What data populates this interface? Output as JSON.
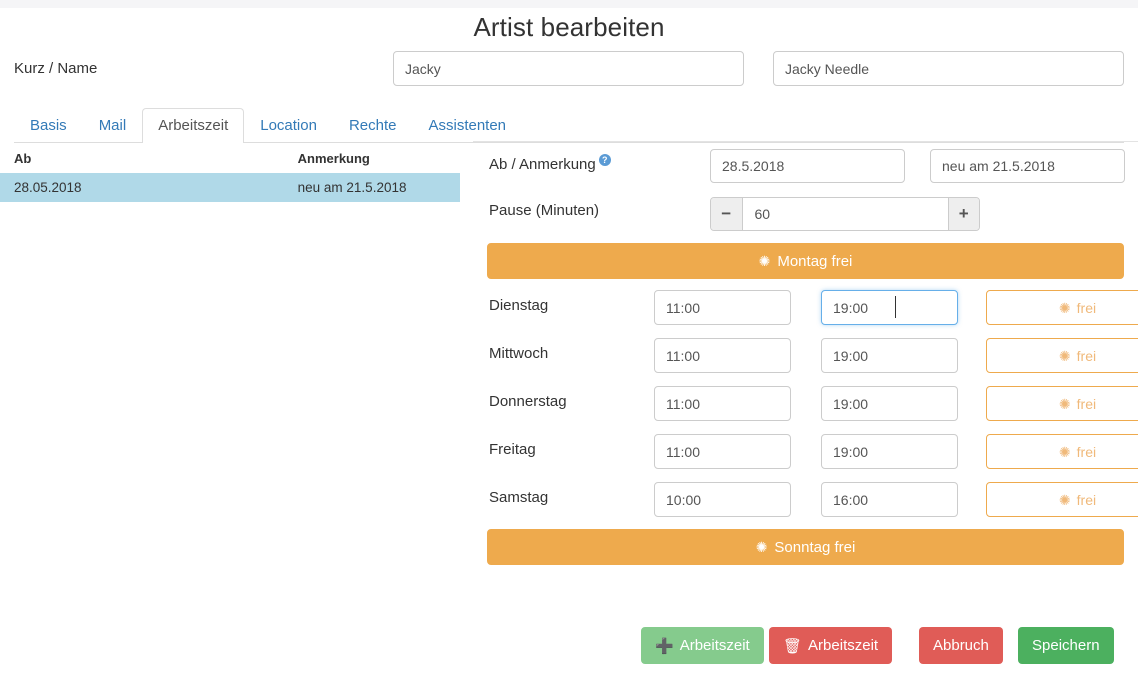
{
  "header": {
    "title": "Artist bearbeiten",
    "kurz_name_label": "Kurz / Name",
    "short_name_value": "Jacky",
    "full_name_value": "Jacky Needle"
  },
  "tabs": [
    {
      "label": "Basis",
      "active": false
    },
    {
      "label": "Mail",
      "active": false
    },
    {
      "label": "Arbeitszeit",
      "active": true
    },
    {
      "label": "Location",
      "active": false
    },
    {
      "label": "Rechte",
      "active": false
    },
    {
      "label": "Assistenten",
      "active": false
    }
  ],
  "table": {
    "headers": [
      "Ab",
      "Anmerkung"
    ],
    "rows": [
      {
        "ab": "28.05.2018",
        "anmerkung": "neu am 21.5.2018",
        "selected": true
      }
    ]
  },
  "form": {
    "ab_anmerkung_label": "Ab / Anmerkung",
    "help_icon": "question-mark-icon",
    "ab_date_value": "28.5.2018",
    "ab_note_value": "neu am 21.5.2018",
    "pause_label": "Pause (Minuten)",
    "pause_value": "60",
    "pause_minus_label": "−",
    "pause_plus_label": "+"
  },
  "schedule": {
    "monday_bar": {
      "label": "Montag frei",
      "icon": "sun-icon"
    },
    "sunday_bar": {
      "label": "Sonntag frei",
      "icon": "sun-icon"
    },
    "free_button_label": "frei",
    "free_button_icon": "sun-icon",
    "days": [
      {
        "name": "Dienstag",
        "from": "11:00",
        "to": "19:00",
        "focused": true
      },
      {
        "name": "Mittwoch",
        "from": "11:00",
        "to": "19:00",
        "focused": false
      },
      {
        "name": "Donnerstag",
        "from": "11:00",
        "to": "19:00",
        "focused": false
      },
      {
        "name": "Freitag",
        "from": "11:00",
        "to": "19:00",
        "focused": false
      },
      {
        "name": "Samstag",
        "from": "10:00",
        "to": "16:00",
        "focused": false
      }
    ]
  },
  "footer": {
    "add_time_label": "Arbeitszeit",
    "add_time_icon": "plus-icon",
    "delete_time_label": "Arbeitszeit",
    "delete_time_icon": "trash-icon",
    "cancel_label": "Abbruch",
    "save_label": "Speichern"
  },
  "colors": {
    "accent_orange": "#eeaa4d",
    "link_blue": "#337ab7",
    "row_highlight": "#b0d9e8",
    "focus_blue": "#66afe9",
    "green": "#4cb05f",
    "green_light": "#85cb8d",
    "red": "#e05c57"
  }
}
